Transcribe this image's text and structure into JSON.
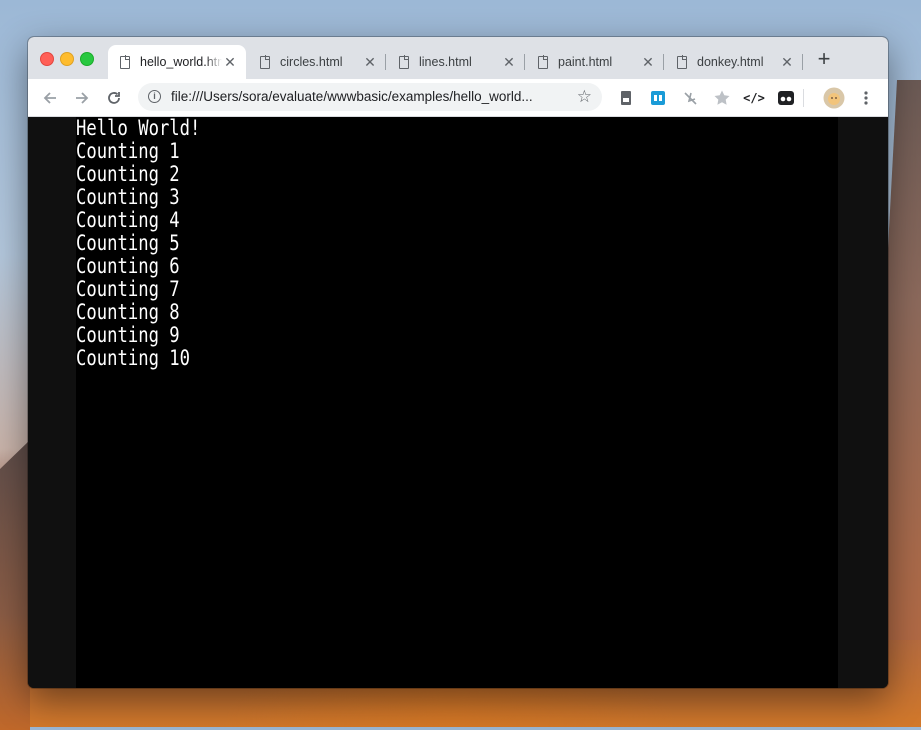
{
  "browser": {
    "tabs": [
      {
        "title": "hello_world.html",
        "active": true
      },
      {
        "title": "circles.html",
        "active": false
      },
      {
        "title": "lines.html",
        "active": false
      },
      {
        "title": "paint.html",
        "active": false
      },
      {
        "title": "donkey.html",
        "active": false
      }
    ],
    "tab_close_glyph": "✕",
    "new_tab_glyph": "+",
    "address_bar": {
      "url": "file:///Users/sora/evaluate/wwwbasic/examples/hello_world..."
    }
  },
  "icons": {
    "back": "back-arrow-icon",
    "forward": "forward-arrow-icon",
    "reload": "reload-icon",
    "info": "info-icon",
    "bookmark": "star-icon",
    "extensions": [
      "document-extension-icon",
      "blue-extension-icon",
      "pin-extension-icon",
      "star-extension-icon",
      "code-extension-icon",
      "mask-extension-icon",
      "profile-avatar",
      "menu-dots-icon"
    ]
  },
  "console": {
    "lines": [
      "Hello World!",
      "Counting 1",
      "Counting 2",
      "Counting 3",
      "Counting 4",
      "Counting 5",
      "Counting 6",
      "Counting 7",
      "Counting 8",
      "Counting 9",
      "Counting 10"
    ],
    "text_color": "#ffffff",
    "background": "#000000"
  }
}
